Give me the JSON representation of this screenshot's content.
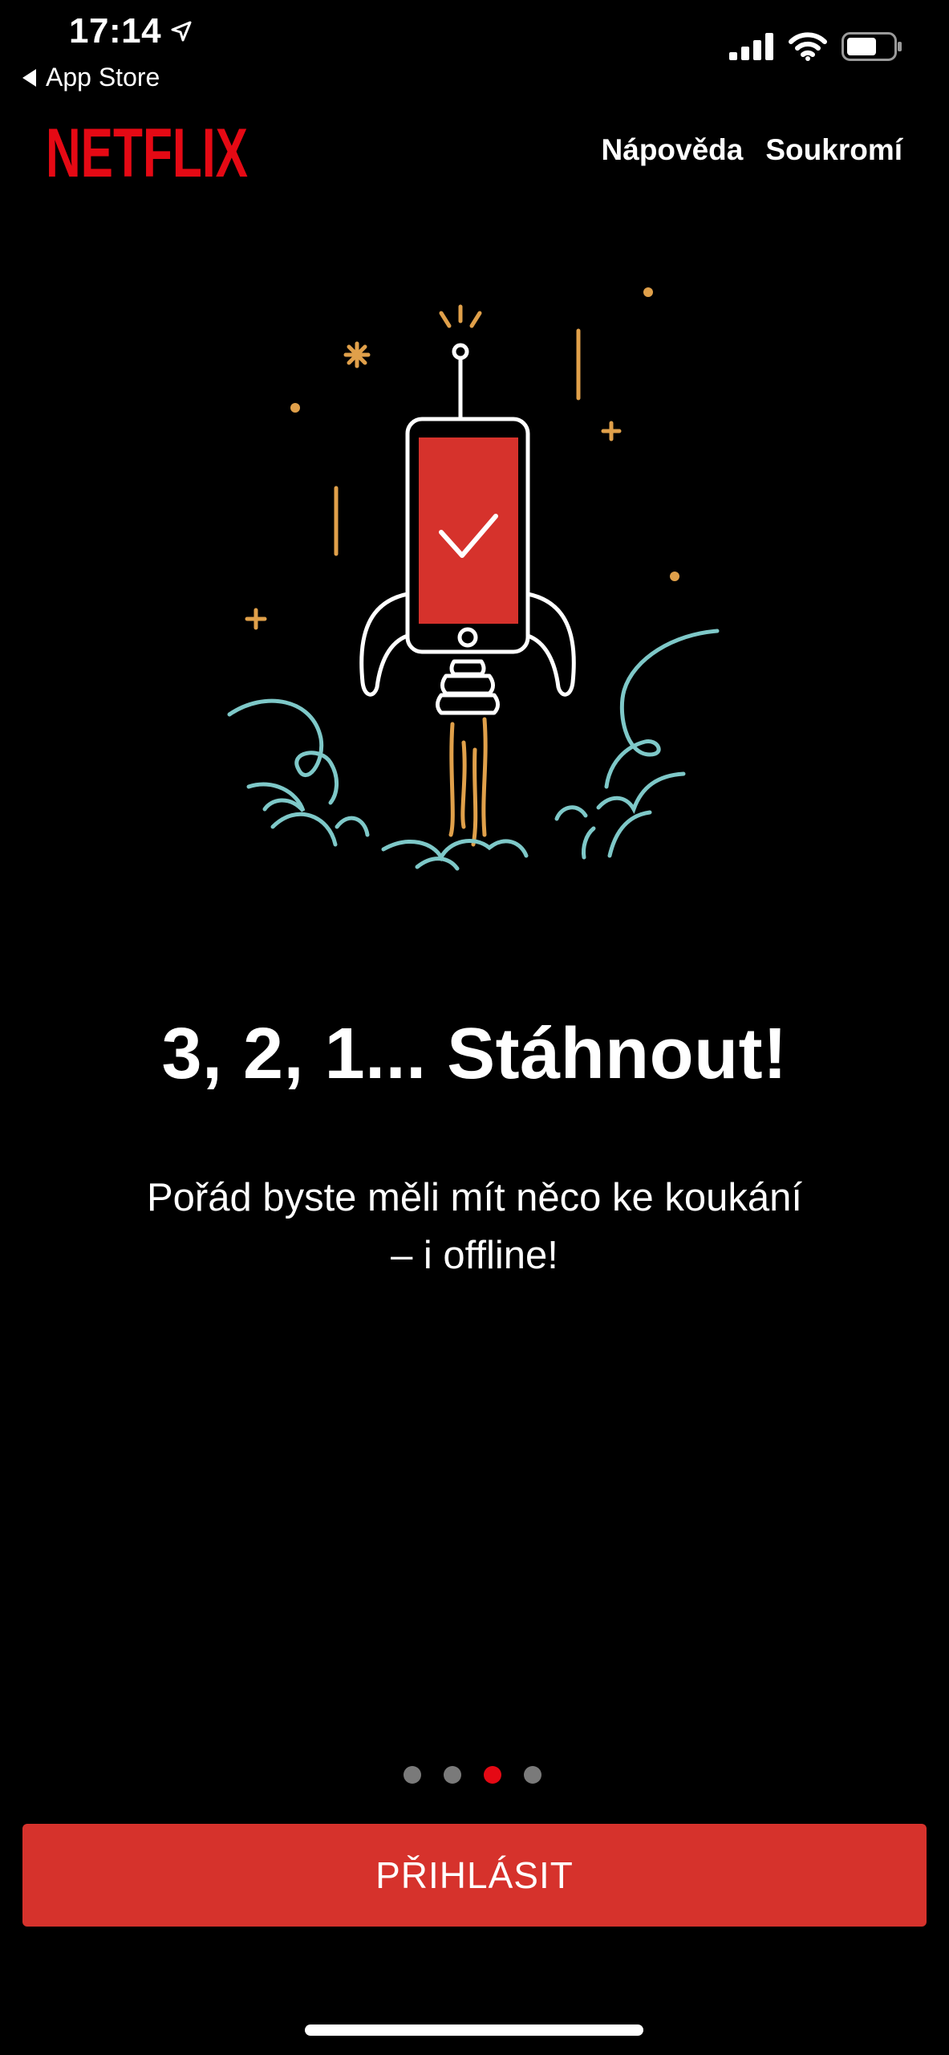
{
  "status_bar": {
    "time": "17:14",
    "back_label": "App Store",
    "icons": [
      "location-arrow-icon",
      "cellular-signal-icon",
      "wifi-icon",
      "battery-icon"
    ]
  },
  "header": {
    "logo_text": "NETFLIX",
    "links": [
      "Nápověda",
      "Soukromí"
    ]
  },
  "illustration": {
    "name": "rocket-phone-illustration",
    "colors": {
      "outline": "#ffffff",
      "screen": "#d6322c",
      "sparks": "#e0a04a",
      "clouds": "#7ec8c8"
    }
  },
  "content": {
    "headline": "3, 2, 1... Stáhnout!",
    "subtitle": "Pořád byste měli mít něco ke koukání\n– i offline!"
  },
  "pager": {
    "count": 4,
    "active_index": 2
  },
  "cta": {
    "label": "PŘIHLÁSIT"
  },
  "colors": {
    "background": "#000000",
    "brand_red": "#e50914",
    "button_red": "#d6322c",
    "dot_inactive": "#7a7a7a"
  }
}
